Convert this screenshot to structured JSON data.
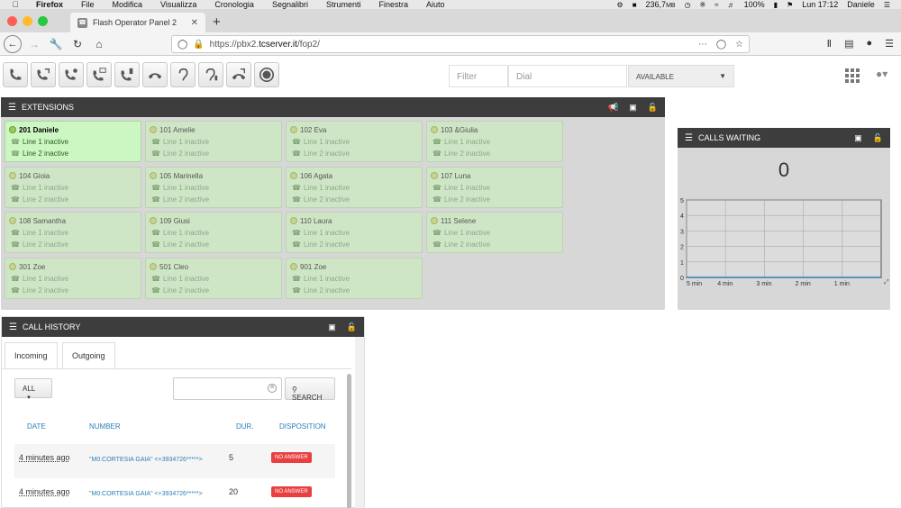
{
  "menubar": {
    "app": "Firefox",
    "menus": [
      "File",
      "Modifica",
      "Visualizza",
      "Cronologia",
      "Segnalibri",
      "Strumenti",
      "Finestra",
      "Aiuto"
    ],
    "memory": "236,7",
    "memory_unit": "MB",
    "battery": "100%",
    "clock": "Lun 17:12",
    "user": "Daniele"
  },
  "browser": {
    "tab_title": "Flash Operator Panel 2",
    "url_prefix": "https://pbx2.",
    "url_domain": "tcserver.it",
    "url_path": "/fop2/"
  },
  "toolbar": {
    "filter_placeholder": "Filter",
    "dial_placeholder": "Dial",
    "status": "AVAILABLE"
  },
  "extensions_panel": {
    "title": "EXTENSIONS",
    "extensions": [
      {
        "name": "201 Daniele",
        "line1": "Line 1 inactive",
        "line2": "Line 2 inactive",
        "active": true
      },
      {
        "name": "101 Amelie",
        "line1": "Line 1 inactive",
        "line2": "Line 2 inactive",
        "active": false
      },
      {
        "name": "102 Eva",
        "line1": "Line 1 inactive",
        "line2": "Line 2 inactive",
        "active": false
      },
      {
        "name": "103 &Giulia",
        "line1": "Line 1 inactive",
        "line2": "Line 2 inactive",
        "active": false
      },
      {
        "name": "104 Gioia",
        "line1": "Line 1 inactive",
        "line2": "Line 2 inactive",
        "active": false
      },
      {
        "name": "105 Marinella",
        "line1": "Line 1 inactive",
        "line2": "Line 2 inactive",
        "active": false
      },
      {
        "name": "106 Agata",
        "line1": "Line 1 inactive",
        "line2": "Line 2 inactive",
        "active": false
      },
      {
        "name": "107 Luna",
        "line1": "Line 1 inactive",
        "line2": "Line 2 inactive",
        "active": false
      },
      {
        "name": "108 Samantha",
        "line1": "Line 1 inactive",
        "line2": "Line 2 inactive",
        "active": false
      },
      {
        "name": "109 Giusi",
        "line1": "Line 1 inactive",
        "line2": "Line 2 inactive",
        "active": false
      },
      {
        "name": "110 Laura",
        "line1": "Line 1 inactive",
        "line2": "Line 2 inactive",
        "active": false
      },
      {
        "name": "111 Selene",
        "line1": "Line 1 inactive",
        "line2": "Line 2 inactive",
        "active": false
      },
      {
        "name": "301 Zoe",
        "line1": "Line 1 inactive",
        "line2": "Line 2 inactive",
        "active": false
      },
      {
        "name": "501 Cleo",
        "line1": "Line 1 inactive",
        "line2": "Line 2 inactive",
        "active": false
      },
      {
        "name": "901 Zoe",
        "line1": "Line 1 inactive",
        "line2": "Line 2 inactive",
        "active": false
      }
    ]
  },
  "calls_waiting": {
    "title": "CALLS WAITING",
    "count": "0"
  },
  "chart_data": {
    "type": "line",
    "categories": [
      "5 min",
      "4 min",
      "3 min",
      "2 min",
      "1 min"
    ],
    "y_ticks": [
      "0",
      "1",
      "2",
      "3",
      "4",
      "5"
    ],
    "series": [
      {
        "values": [
          0,
          0,
          0,
          0,
          0
        ]
      }
    ],
    "ylim": [
      0,
      5
    ],
    "grid": true,
    "title": "",
    "xlabel": "",
    "ylabel": ""
  },
  "call_history": {
    "title": "CALL HISTORY",
    "tabs": [
      "Incoming",
      "Outgoing"
    ],
    "filter": "ALL",
    "search_button": "SEARCH",
    "columns": [
      "DATE",
      "NUMBER",
      "DUR.",
      "DISPOSITION"
    ],
    "rows": [
      {
        "date": "4 minutes ago",
        "number": "\"M0:CORTESIA GAIA\" <+3934726*****>",
        "dur": "5",
        "disposition": "NO ANSWER"
      },
      {
        "date": "4 minutes ago",
        "number": "\"M0:CORTESIA GAIA\" <+3934726*****>",
        "dur": "20",
        "disposition": "NO ANSWER"
      }
    ]
  },
  "colors": {
    "panel_header": "#3d3d3d",
    "extension_idle": "#cfe6c6",
    "extension_active": "#ccf7c2",
    "link_blue": "#2c7fb8",
    "no_answer_red": "#e84040"
  }
}
